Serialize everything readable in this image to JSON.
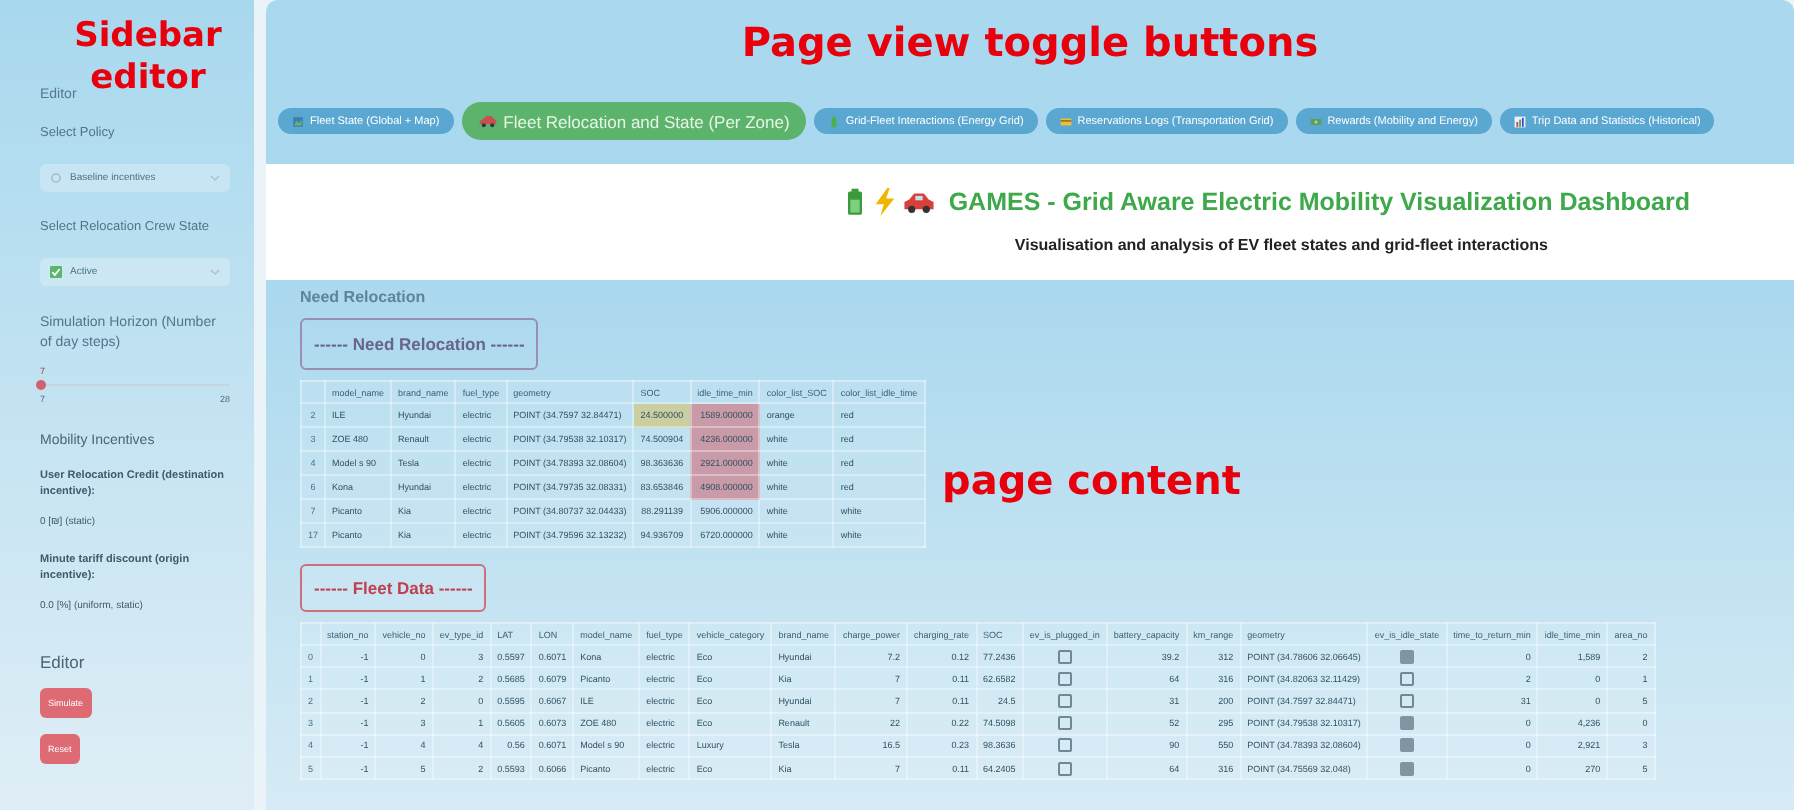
{
  "sidebar_annotation": "Sidebar editor",
  "toggle_annotation": "Page view toggle buttons",
  "content_annotation": "page content",
  "sidebar": {
    "heading": "Editor",
    "policy_label": "Select Policy",
    "policy_value": "Baseline incentives",
    "crew_label": "Select Relocation Crew State",
    "crew_value": "Active",
    "horizon_label": "Simulation Horizon (Number of day steps)",
    "slider": {
      "value": "7",
      "min": "7",
      "max": "28",
      "level": 0
    },
    "incentives_heading": "Mobility Incentives",
    "incentives": [
      {
        "label": "User Relocation Credit (destination incentive):",
        "value": "0 [₪] (static)"
      },
      {
        "label": "Minute tariff discount (origin incentive):",
        "value": "0.0 [%] (uniform, static)"
      }
    ],
    "editor_heading": "Editor",
    "buttons": [
      "Simulate",
      "Reset"
    ]
  },
  "views": [
    {
      "label": "Fleet State (Global + Map)",
      "kind": "map",
      "selected": false
    },
    {
      "label": "Fleet Relocation and State (Per Zone)",
      "kind": "car",
      "selected": true
    },
    {
      "label": "Grid-Fleet Interactions (Energy Grid)",
      "kind": "battery",
      "selected": false
    },
    {
      "label": "Reservations Logs (Transportation Grid)",
      "kind": "card",
      "selected": false
    },
    {
      "label": "Rewards (Mobility and Energy)",
      "kind": "money",
      "selected": false
    },
    {
      "label": "Trip Data and Statistics (Historical)",
      "kind": "chart",
      "selected": false
    }
  ],
  "title": {
    "text": "GAMES - Grid Aware Electric Mobility Visualization Dashboard",
    "subtitle": "Visualisation and analysis of EV fleet states and grid-fleet interactions"
  },
  "content": {
    "heading": "Need Relocation",
    "relocation_box": "------ Need Relocation ------",
    "relocation_table": {
      "columns": [
        "",
        "model_name",
        "brand_name",
        "fuel_type",
        "geometry",
        "SOC",
        "idle_time_min",
        "color_list_SOC",
        "color_list_idle_time"
      ],
      "rows": [
        [
          {
            "text": "2"
          },
          {
            "text": "ILE"
          },
          {
            "text": "Hyundai"
          },
          {
            "text": "electric"
          },
          {
            "text": "POINT (34.7597 32.84471)"
          },
          {
            "text": "24.500000",
            "color": "#c9cfa0"
          },
          {
            "text": "1589.000000",
            "color": "#c99aa8"
          },
          {
            "text": "orange"
          },
          {
            "text": "red"
          }
        ],
        [
          {
            "text": "3"
          },
          {
            "text": "ZOE 480"
          },
          {
            "text": "Renault"
          },
          {
            "text": "electric"
          },
          {
            "text": "POINT (34.79538 32.10317)"
          },
          {
            "text": "74.500904"
          },
          {
            "text": "4236.000000",
            "color": "#c99aa8"
          },
          {
            "text": "white"
          },
          {
            "text": "red"
          }
        ],
        [
          {
            "text": "4"
          },
          {
            "text": "Model s 90"
          },
          {
            "text": "Tesla"
          },
          {
            "text": "electric"
          },
          {
            "text": "POINT (34.78393 32.08604)"
          },
          {
            "text": "98.363636"
          },
          {
            "text": "2921.000000",
            "color": "#c99aa8"
          },
          {
            "text": "white"
          },
          {
            "text": "red"
          }
        ],
        [
          {
            "text": "6"
          },
          {
            "text": "Kona"
          },
          {
            "text": "Hyundai"
          },
          {
            "text": "electric"
          },
          {
            "text": "POINT (34.79735 32.08331)"
          },
          {
            "text": "83.653846"
          },
          {
            "text": "4908.000000",
            "color": "#c99aa8"
          },
          {
            "text": "white"
          },
          {
            "text": "red"
          }
        ],
        [
          {
            "text": "7"
          },
          {
            "text": "Picanto"
          },
          {
            "text": "Kia"
          },
          {
            "text": "electric"
          },
          {
            "text": "POINT (34.80737 32.04433)"
          },
          {
            "text": "88.291139"
          },
          {
            "text": "5906.000000"
          },
          {
            "text": "white"
          },
          {
            "text": "white"
          }
        ],
        [
          {
            "text": "17"
          },
          {
            "text": "Picanto"
          },
          {
            "text": "Kia"
          },
          {
            "text": "electric"
          },
          {
            "text": "POINT (34.79596 32.13232)"
          },
          {
            "text": "94.936709"
          },
          {
            "text": "6720.000000"
          },
          {
            "text": "white"
          },
          {
            "text": "white"
          }
        ]
      ]
    },
    "fleet_box": "------ Fleet Data ------",
    "fleet_table": {
      "columns": [
        "",
        "station_no",
        "vehicle_no",
        "ev_type_id",
        "LAT",
        "LON",
        "model_name",
        "fuel_type",
        "vehicle_category",
        "brand_name",
        "charge_power",
        "charging_rate",
        "SOC",
        "ev_is_plugged_in",
        "battery_capacity",
        "km_range",
        "geometry",
        "ev_is_idle_state",
        "time_to_return_min",
        "idle_time_min",
        "area_no"
      ],
      "rows": [
        [
          {
            "text": "0"
          },
          {
            "text": "-1"
          },
          {
            "text": "0"
          },
          {
            "text": "3"
          },
          {
            "text": "0.5597"
          },
          {
            "text": "0.6071"
          },
          {
            "text": "Kona"
          },
          {
            "text": "electric"
          },
          {
            "text": "Eco"
          },
          {
            "text": "Hyundai"
          },
          {
            "text": "7.2"
          },
          {
            "text": "0.12"
          },
          {
            "text": "77.2436"
          },
          {
            "checked": false
          },
          {
            "text": "39.2"
          },
          {
            "text": "312"
          },
          {
            "text": "POINT (34.78606 32.06645)"
          },
          {
            "checked": true
          },
          {
            "text": "0"
          },
          {
            "text": "1,589"
          },
          {
            "text": "2"
          }
        ],
        [
          {
            "text": "1"
          },
          {
            "text": "-1"
          },
          {
            "text": "1"
          },
          {
            "text": "2"
          },
          {
            "text": "0.5685"
          },
          {
            "text": "0.6079"
          },
          {
            "text": "Picanto"
          },
          {
            "text": "electric"
          },
          {
            "text": "Eco"
          },
          {
            "text": "Kia"
          },
          {
            "text": "7"
          },
          {
            "text": "0.11"
          },
          {
            "text": "62.6582"
          },
          {
            "checked": false
          },
          {
            "text": "64"
          },
          {
            "text": "316"
          },
          {
            "text": "POINT (34.82063 32.11429)"
          },
          {
            "checked": false
          },
          {
            "text": "2"
          },
          {
            "text": "0"
          },
          {
            "text": "1"
          }
        ],
        [
          {
            "text": "2"
          },
          {
            "text": "-1"
          },
          {
            "text": "2"
          },
          {
            "text": "0"
          },
          {
            "text": "0.5595"
          },
          {
            "text": "0.6067"
          },
          {
            "text": "ILE"
          },
          {
            "text": "electric"
          },
          {
            "text": "Eco"
          },
          {
            "text": "Hyundai"
          },
          {
            "text": "7"
          },
          {
            "text": "0.11"
          },
          {
            "text": "24.5"
          },
          {
            "checked": false
          },
          {
            "text": "31"
          },
          {
            "text": "200"
          },
          {
            "text": "POINT (34.7597 32.84471)"
          },
          {
            "checked": false
          },
          {
            "text": "31"
          },
          {
            "text": "0"
          },
          {
            "text": "5"
          }
        ],
        [
          {
            "text": "3"
          },
          {
            "text": "-1"
          },
          {
            "text": "3"
          },
          {
            "text": "1"
          },
          {
            "text": "0.5605"
          },
          {
            "text": "0.6073"
          },
          {
            "text": "ZOE 480"
          },
          {
            "text": "electric"
          },
          {
            "text": "Eco"
          },
          {
            "text": "Renault"
          },
          {
            "text": "22"
          },
          {
            "text": "0.22"
          },
          {
            "text": "74.5098"
          },
          {
            "checked": false
          },
          {
            "text": "52"
          },
          {
            "text": "295"
          },
          {
            "text": "POINT (34.79538 32.10317)"
          },
          {
            "checked": true
          },
          {
            "text": "0"
          },
          {
            "text": "4,236"
          },
          {
            "text": "0"
          }
        ],
        [
          {
            "text": "4"
          },
          {
            "text": "-1"
          },
          {
            "text": "4"
          },
          {
            "text": "4"
          },
          {
            "text": "0.56"
          },
          {
            "text": "0.6071"
          },
          {
            "text": "Model s 90"
          },
          {
            "text": "electric"
          },
          {
            "text": "Luxury"
          },
          {
            "text": "Tesla"
          },
          {
            "text": "16.5"
          },
          {
            "text": "0.23"
          },
          {
            "text": "98.3636"
          },
          {
            "checked": false
          },
          {
            "text": "90"
          },
          {
            "text": "550"
          },
          {
            "text": "POINT (34.78393 32.08604)"
          },
          {
            "checked": true
          },
          {
            "text": "0"
          },
          {
            "text": "2,921"
          },
          {
            "text": "3"
          }
        ],
        [
          {
            "text": "5"
          },
          {
            "text": "-1"
          },
          {
            "text": "5"
          },
          {
            "text": "2"
          },
          {
            "text": "0.5593"
          },
          {
            "text": "0.6066"
          },
          {
            "text": "Picanto"
          },
          {
            "text": "electric"
          },
          {
            "text": "Eco"
          },
          {
            "text": "Kia"
          },
          {
            "text": "7"
          },
          {
            "text": "0.11"
          },
          {
            "text": "64.2405"
          },
          {
            "checked": false
          },
          {
            "text": "64"
          },
          {
            "text": "316"
          },
          {
            "text": "POINT (34.75569 32.048)"
          },
          {
            "checked": true
          },
          {
            "text": "0"
          },
          {
            "text": "270"
          },
          {
            "text": "5"
          }
        ]
      ]
    }
  }
}
